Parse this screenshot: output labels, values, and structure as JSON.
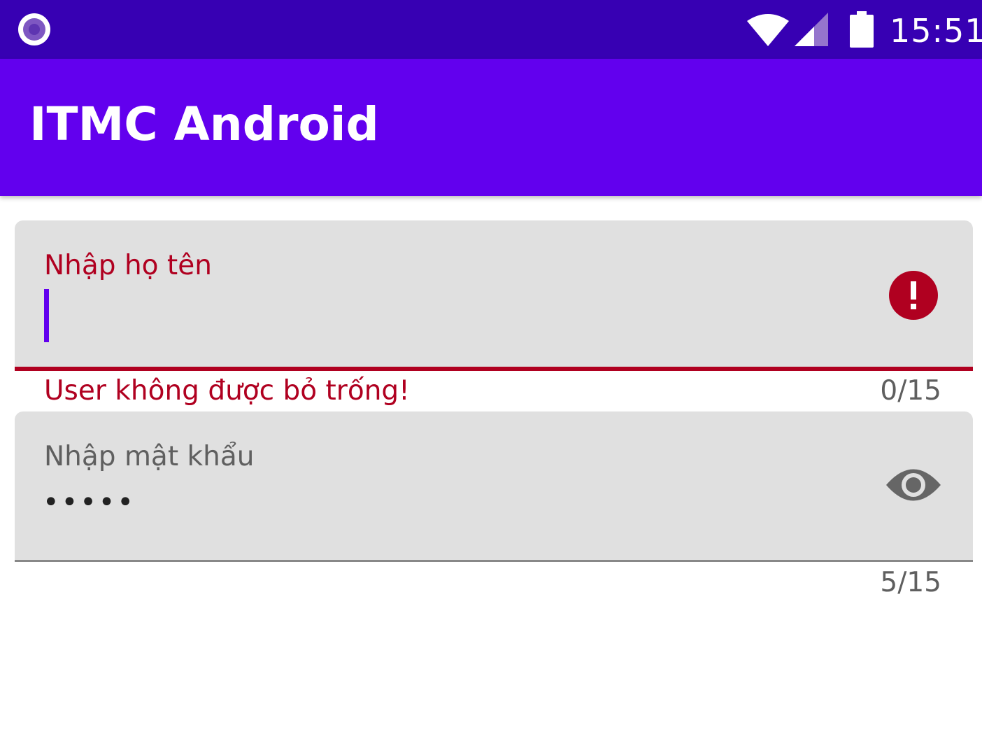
{
  "status_bar": {
    "time": "15:51",
    "icons": [
      "notification-dot-icon",
      "wifi-icon",
      "cell-signal-icon",
      "battery-icon"
    ]
  },
  "app_bar": {
    "title": "ITMC Android"
  },
  "form": {
    "username": {
      "label": "Nhập họ tên",
      "value": "",
      "error": "User không được bỏ trống!",
      "counter": "0/15",
      "trailing_icon": "error-icon"
    },
    "password": {
      "label": "Nhập mật khẩu",
      "masked_value": "•••••",
      "counter": "5/15",
      "trailing_icon": "eye-icon"
    }
  },
  "colors": {
    "status_bar": "#3700b3",
    "primary": "#6200ee",
    "error": "#b00020",
    "field_fill": "#e0e0e0",
    "hint_text": "#5f5f5f"
  }
}
